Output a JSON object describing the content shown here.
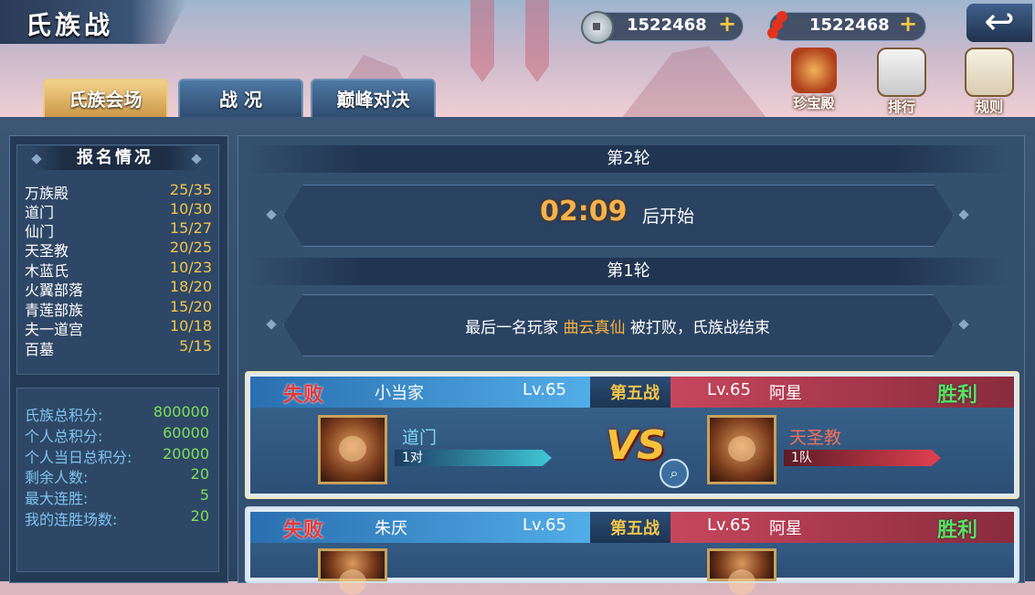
{
  "header": {
    "title": "氏族战",
    "currency": [
      {
        "icon": "silver-coin-icon",
        "value": "1522468",
        "plus": "+"
      },
      {
        "icon": "candied-haw-icon",
        "value": "1522468",
        "plus": "+"
      }
    ],
    "back_icon": "back-arrow-icon",
    "shortcuts": [
      {
        "label": "珍宝殿",
        "icon": "treasure-hall-icon"
      },
      {
        "label": "排行",
        "icon": "ranking-icon"
      },
      {
        "label": "规则",
        "icon": "rules-icon"
      }
    ]
  },
  "tabs": [
    {
      "label": "氏族会场",
      "active": true
    },
    {
      "label": "战 况",
      "active": false
    },
    {
      "label": "巅峰对决",
      "active": false
    }
  ],
  "registration": {
    "title": "报名情况",
    "rows": [
      {
        "name": "万族殿",
        "value": "25/35"
      },
      {
        "name": "道门",
        "value": "10/30"
      },
      {
        "name": "仙门",
        "value": "15/27"
      },
      {
        "name": "天圣教",
        "value": "20/25"
      },
      {
        "name": "木蓝氏",
        "value": "10/23"
      },
      {
        "name": "火翼部落",
        "value": "18/20"
      },
      {
        "name": "青莲部族",
        "value": "15/20"
      },
      {
        "name": "夫一道宫",
        "value": "10/18"
      },
      {
        "name": "百墓",
        "value": "5/15"
      }
    ]
  },
  "stats": [
    {
      "name": "氏族总积分:",
      "value": "800000"
    },
    {
      "name": "个人总积分:",
      "value": "60000"
    },
    {
      "name": "个人当日总积分:",
      "value": "20000"
    },
    {
      "name": "剩余人数:",
      "value": "20"
    },
    {
      "name": "最大连胜:",
      "value": "5"
    },
    {
      "name": "我的连胜场数:",
      "value": "20"
    }
  ],
  "round2": {
    "title": "第2轮",
    "timer": "02:09",
    "suffix": "后开始"
  },
  "round1": {
    "title": "第1轮",
    "msg_pre": "最后一名玩家",
    "msg_player": "曲云真仙",
    "msg_post": "被打败，氏族战结束"
  },
  "battles": [
    {
      "left": {
        "result": "失败",
        "name": "小当家",
        "level": "Lv.65",
        "clan": "道门",
        "team": "1对"
      },
      "fight": "第五战",
      "right": {
        "result": "胜利",
        "name": "阿星",
        "level": "Lv.65",
        "clan": "天圣教",
        "team": "1队"
      },
      "vs": "VS"
    },
    {
      "left": {
        "result": "失败",
        "name": "朱厌",
        "level": "Lv.65"
      },
      "fight": "第五战",
      "right": {
        "result": "胜利",
        "name": "阿星",
        "level": "Lv.65"
      }
    }
  ],
  "colors": {
    "win": "#5ce063",
    "lose": "#e53a3a",
    "gold": "#f4c44a",
    "stat_value": "#7de05a"
  }
}
